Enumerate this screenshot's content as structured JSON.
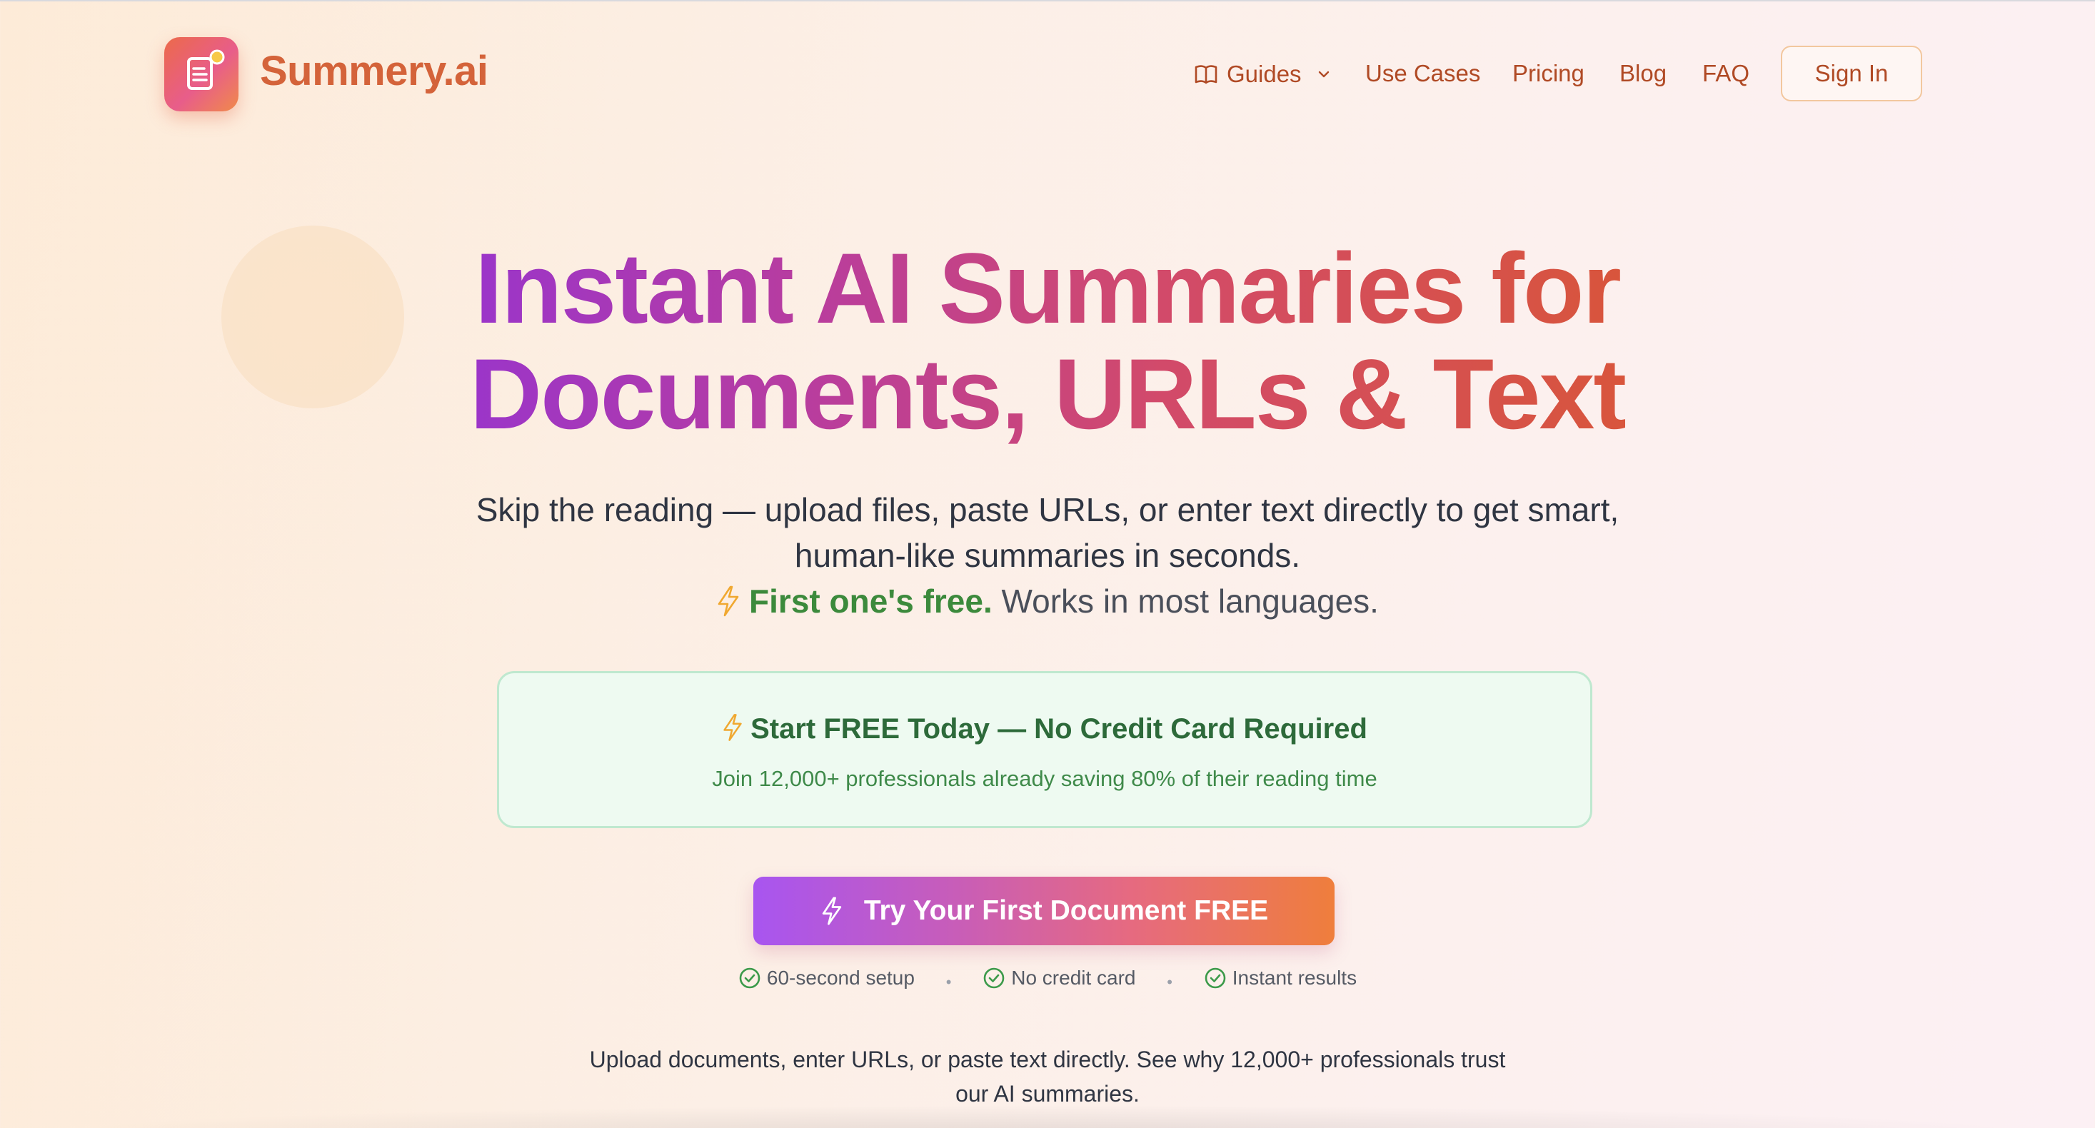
{
  "header": {
    "brand": "Summery.ai",
    "logo_icon": "document-icon",
    "nav": {
      "guides": "Guides",
      "use_cases": "Use Cases",
      "pricing": "Pricing",
      "blog": "Blog",
      "faq": "FAQ"
    },
    "sign_in": "Sign In"
  },
  "hero": {
    "title_line1": "Instant AI Summaries for",
    "title_line2": "Documents, URLs & Text",
    "subtitle_line1": "Skip the reading — upload files, paste URLs, or enter text directly to get smart,",
    "subtitle_line2": "human-like summaries in seconds.",
    "free_strong": "First one's free.",
    "free_rest": "Works in most languages."
  },
  "promo": {
    "title": "Start FREE Today — No Credit Card Required",
    "subtitle": "Join 12,000+ professionals already saving 80% of their reading time"
  },
  "cta": {
    "label": "Try Your First Document FREE"
  },
  "checks": [
    "60-second setup",
    "No credit card",
    "Instant results"
  ],
  "bottom": {
    "line1": "Upload documents, enter URLs, or paste text directly. See why 12,000+ professionals trust",
    "line2": "our AI summaries."
  },
  "colors": {
    "brand": "#d4633a",
    "nav": "#b04a25",
    "green": "#3c8a3c",
    "cta_start": "#a855f0",
    "cta_end": "#ef7e3c"
  }
}
